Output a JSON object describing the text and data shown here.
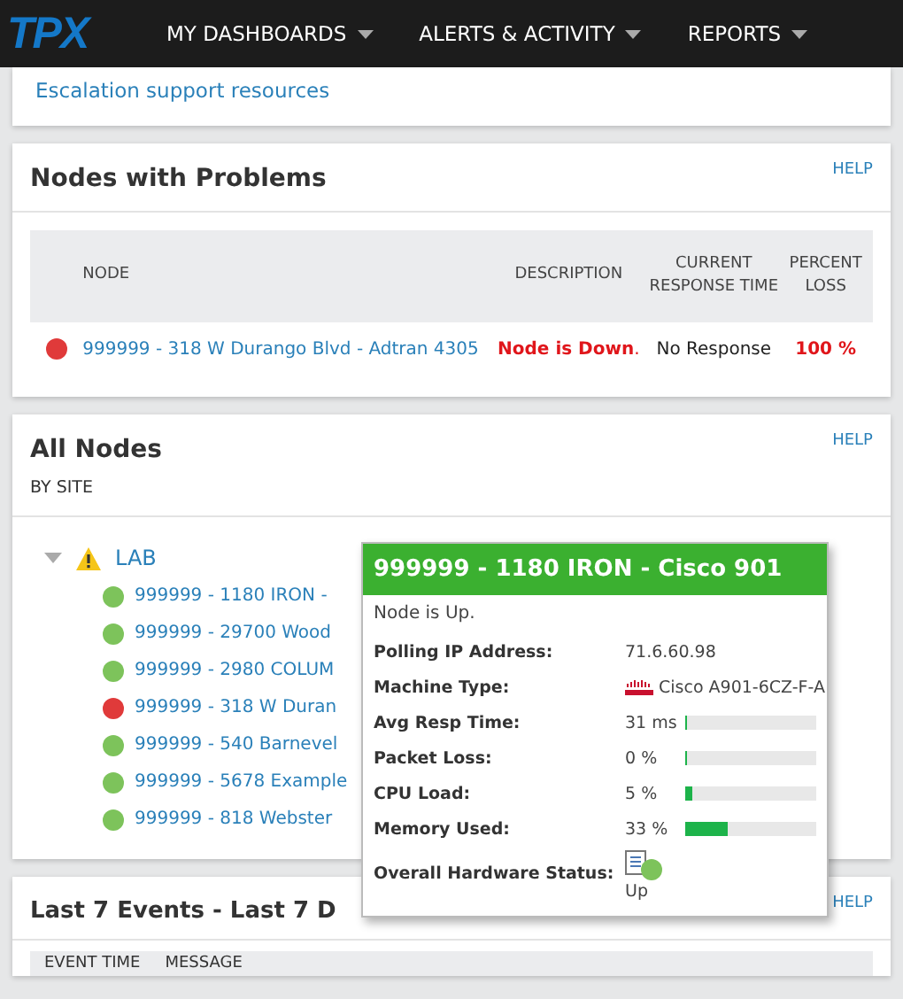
{
  "nav": {
    "logo": "TPX",
    "menus": [
      {
        "label": "MY DASHBOARDS"
      },
      {
        "label": "ALERTS & ACTIVITY"
      },
      {
        "label": "REPORTS"
      }
    ]
  },
  "links_card": {
    "link": "Escalation support resources"
  },
  "problems": {
    "title": "Nodes with Problems",
    "help": "HELP",
    "columns": [
      "NODE",
      "DESCRIPTION",
      "CURRENT RESPONSE TIME",
      "PERCENT LOSS"
    ],
    "rows": [
      {
        "color": "#e03a3a",
        "node": "999999 - 318 W Durango Blvd - Adtran 4305",
        "description": "Node is Down",
        "description_tail": ".",
        "response": "No Response",
        "loss": "100 %"
      }
    ]
  },
  "all_nodes": {
    "title": "All Nodes",
    "subtitle": "BY SITE",
    "help": "HELP",
    "sites": [
      {
        "name": "LAB",
        "expanded": true,
        "children": [
          {
            "name": "999999 - 1180 IRON -",
            "color": "#7dc35b"
          },
          {
            "name": "999999 - 29700 Wood",
            "color": "#7dc35b"
          },
          {
            "name": "999999 - 2980 COLUM",
            "color": "#7dc35b"
          },
          {
            "name": "999999 - 318 W Duran",
            "color": "#e03a3a"
          },
          {
            "name": "999999 - 540 Barnevel",
            "color": "#7dc35b"
          },
          {
            "name": "999999 - 5678 Example",
            "color": "#7dc35b"
          },
          {
            "name": "999999 - 818 Webster",
            "color": "#7dc35b"
          }
        ]
      }
    ]
  },
  "tooltip": {
    "title": "999999 - 1180 IRON - Cisco 901",
    "status": "Node is Up.",
    "rows": [
      {
        "kind": "text",
        "label": "Polling IP Address:",
        "value": "71.6.60.98"
      },
      {
        "kind": "vendor",
        "label": "Machine Type:",
        "value": "Cisco A901-6CZ-F-A"
      },
      {
        "kind": "bar",
        "label": "Avg Resp Time:",
        "value": "31 ms",
        "level": 0.01
      },
      {
        "kind": "bar",
        "label": "Packet Loss:",
        "value": "0 %",
        "level": 0
      },
      {
        "kind": "bar",
        "label": "CPU Load:",
        "value": "5 %",
        "level": 0.05
      },
      {
        "kind": "bar",
        "label": "Memory Used:",
        "value": "33 %",
        "level": 0.33
      },
      {
        "kind": "hardware",
        "label": "Overall Hardware Status:",
        "value": "Up"
      }
    ]
  },
  "events": {
    "title": "Last 7 Events - Last 7 D",
    "help": "HELP",
    "columns": [
      "EVENT TIME",
      "MESSAGE"
    ]
  }
}
